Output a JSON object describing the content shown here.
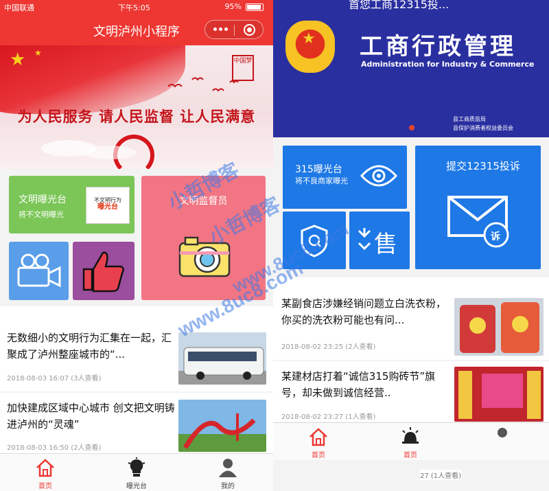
{
  "left": {
    "status": {
      "carrier": "中国联通",
      "time": "下午5:05",
      "battery": "95%"
    },
    "nav": {
      "title": "文明泸州小程序"
    },
    "banner": {
      "slogan": "为人民服务 请人民监督 让人民满意"
    },
    "tiles": {
      "exposure": {
        "title": "文明曝光台",
        "subtitle": "将不文明曝光",
        "pic_line1": "不文明行为",
        "pic_line2": "曝光台"
      },
      "supervisor": {
        "title": "文明监督员"
      }
    },
    "news": [
      {
        "title": "无数细小的文明行为汇集在一起，汇聚成了泸州整座城市的“...",
        "meta": "2018-08-03 16:07  (3人查看)"
      },
      {
        "title": "加快建成区域中心城市 创文把文明铸进泸州的“灵魂”",
        "meta": "2018-08-03 16:50  (2人查看)"
      }
    ],
    "tabs": [
      {
        "label": "首页",
        "icon": "home-icon"
      },
      {
        "label": "曝光台",
        "icon": "lightbulb-icon"
      },
      {
        "label": "我的",
        "icon": "user-icon"
      }
    ]
  },
  "right": {
    "banner": {
      "topline": "首您工商12315投...",
      "title": "工商行政管理",
      "english": "Administration for Industry & Commerce",
      "dept1": "县工商质监局",
      "dept2": "县保护消费者权益委员会"
    },
    "tiles": {
      "exposure": {
        "title": "315曝光台",
        "subtitle": "将不良商家曝光"
      },
      "submit": {
        "title": "提交12315投诉",
        "badge": "诉"
      },
      "aftersale": {
        "glyph": "售"
      }
    },
    "news": [
      {
        "title": "某副食店涉嫌经销问题立白洗衣粉，你买的洗衣粉可能也有问...",
        "meta": "2018-08-02 23:25  (2人查看)"
      },
      {
        "title": "某建材店打着“诚信315购砖节”旗号，却未做到诚信经营..",
        "meta": "2018-08-02 23:27  (1人查看)"
      }
    ],
    "tabs": [
      {
        "label": "首页",
        "icon": "home-icon"
      },
      {
        "label": "首页",
        "icon": "alarm-icon"
      },
      {
        "label": "",
        "icon": "user-icon"
      }
    ],
    "ghost_meta": "27 (1人查看)"
  },
  "watermark": {
    "text1": "小哲博客",
    "text2": "www.8uc8.com"
  },
  "colors": {
    "brand_red": "#ee3732",
    "gov_blue": "#1e78e6",
    "banner_navy": "#2a2fa0"
  }
}
